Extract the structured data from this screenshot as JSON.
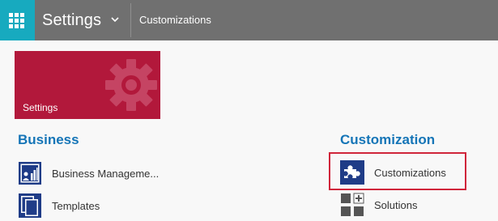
{
  "header": {
    "app_launcher_icon": "waffle-grid-icon",
    "area_title": "Settings",
    "area_chevron_icon": "chevron-down-icon",
    "breadcrumb": "Customizations",
    "colors": {
      "bar": "#707070",
      "launcher": "#17aabf"
    }
  },
  "tile": {
    "label": "Settings",
    "icon": "gear-icon",
    "color": "#b2183b"
  },
  "sections": {
    "business": {
      "title": "Business",
      "items": [
        {
          "label": "Business Manageme...",
          "icon": "business-management-icon"
        },
        {
          "label": "Templates",
          "icon": "templates-icon"
        }
      ]
    },
    "customization": {
      "title": "Customization",
      "items": [
        {
          "label": "Customizations",
          "icon": "puzzle-piece-icon"
        },
        {
          "label": "Solutions",
          "icon": "solutions-icon"
        }
      ]
    }
  },
  "highlight_color": "#d0253a",
  "heading_color": "#1575b7"
}
